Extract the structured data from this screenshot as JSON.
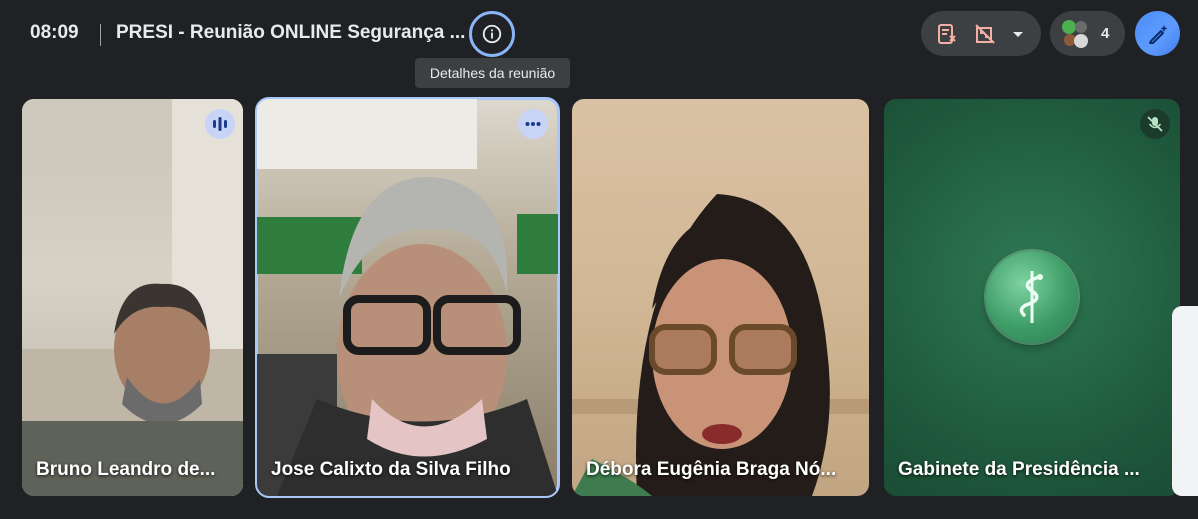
{
  "header": {
    "time": "08:09",
    "title": "PRESI - Reunião ONLINE Segurança ...",
    "tooltip": "Detalhes da reunião"
  },
  "icons": {
    "info": "info-icon",
    "notes": "notes-icon",
    "camera_off": "no-building-icon",
    "dropdown": "chevron-down-icon",
    "participants": "participants-icon",
    "ai": "pen-sparkle-icon"
  },
  "participants": {
    "count": "4"
  },
  "tiles": [
    {
      "name": "Bruno Leandro de...",
      "indicator": "speaking-icon"
    },
    {
      "name": "Jose Calixto da Silva Filho",
      "indicator": "more-options-icon"
    },
    {
      "name": "Débora Eugênia Braga Nó...",
      "indicator": ""
    },
    {
      "name": "Gabinete da Presidência ...",
      "indicator": "mic-off-icon"
    }
  ],
  "colors": {
    "background": "#202124",
    "highlight_border": "#a8c7fa",
    "accent_blue": "#8ab4f8"
  }
}
